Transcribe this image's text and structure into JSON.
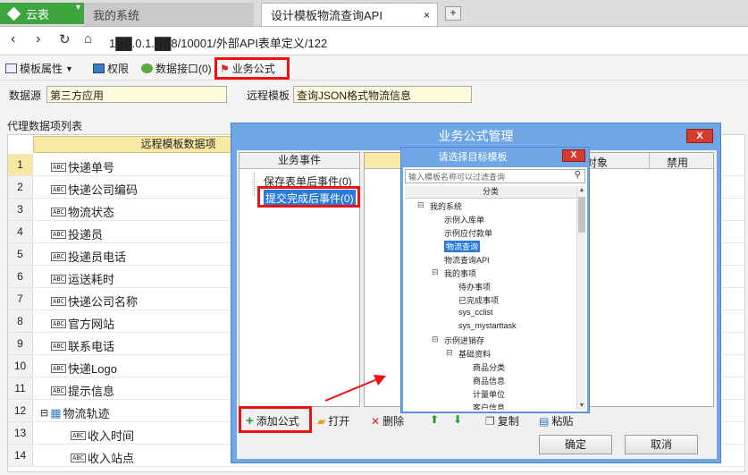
{
  "browser": {
    "brand": "云表",
    "tabs": [
      {
        "label": "我的系统"
      },
      {
        "label": "设计模板物流查询API"
      }
    ],
    "tab_close": "×",
    "new_tab": "+",
    "url": "1██.0.1.██8/10001/外部API表单定义/122"
  },
  "toolbar": {
    "template_props": "模板属性",
    "permissions": "权限",
    "data_interface": "数据接口(0)",
    "business_formula": "业务公式"
  },
  "form": {
    "datasource_label": "数据源",
    "datasource_value": "第三方应用",
    "remote_template_label": "远程模板",
    "remote_template_value": "查询JSON格式物流信息"
  },
  "grid": {
    "title": "代理数据项列表",
    "header": "远程模板数据项",
    "rows": [
      {
        "num": "1",
        "label": "快递单号"
      },
      {
        "num": "2",
        "label": "快递公司编码"
      },
      {
        "num": "3",
        "label": "物流状态"
      },
      {
        "num": "4",
        "label": "投递员"
      },
      {
        "num": "5",
        "label": "投递员电话"
      },
      {
        "num": "6",
        "label": "运送耗时"
      },
      {
        "num": "7",
        "label": "快递公司名称"
      },
      {
        "num": "8",
        "label": "官方网站"
      },
      {
        "num": "9",
        "label": "联系电话"
      },
      {
        "num": "10",
        "label": "快递Logo"
      },
      {
        "num": "11",
        "label": "提示信息"
      },
      {
        "num": "12",
        "label": "物流轨迹"
      },
      {
        "num": "13",
        "label": "收入时间"
      },
      {
        "num": "14",
        "label": "收入站点"
      }
    ]
  },
  "dialog": {
    "title": "业务公式管理",
    "close": "X",
    "events_header": "业务事件",
    "events": [
      "保存表单后事件(0)",
      "提交完成后事件(0)"
    ],
    "right_cols": [
      "对象",
      "禁用"
    ],
    "actions": {
      "add": "添加公式",
      "open": "打开",
      "delete": "删除",
      "copy": "复制",
      "paste": "粘贴"
    },
    "ok": "确定",
    "cancel": "取消"
  },
  "picker": {
    "title": "请选择目标模板",
    "close": "X",
    "filter_placeholder": "输入模板名称可以过滤查询",
    "category_header": "分类",
    "tree": [
      {
        "label": "我的系统",
        "level": 0,
        "toggle": "⊟"
      },
      {
        "label": "示例入库单",
        "level": 1
      },
      {
        "label": "示例应付款单",
        "level": 1
      },
      {
        "label": "物流查询",
        "level": 1,
        "selected": true
      },
      {
        "label": "物流查询API",
        "level": 1
      },
      {
        "label": "我的事项",
        "level": 1,
        "toggle": "⊟"
      },
      {
        "label": "待办事项",
        "level": 2
      },
      {
        "label": "已完成事项",
        "level": 2
      },
      {
        "label": "sys_cclist",
        "level": 2
      },
      {
        "label": "sys_mystarttask",
        "level": 2
      },
      {
        "label": "示例进销存",
        "level": 1,
        "toggle": "⊟"
      },
      {
        "label": "基础资料",
        "level": 2,
        "toggle": "⊟"
      },
      {
        "label": "商品分类",
        "level": 3
      },
      {
        "label": "商品信息",
        "level": 3
      },
      {
        "label": "计量单位",
        "level": 3
      },
      {
        "label": "客户信息",
        "level": 3
      }
    ]
  },
  "colors": {
    "brand_green": "#3ea53e",
    "dialog_blue": "#6fa6e6",
    "highlight_red": "#e11111",
    "selection_blue": "#2a7ad8",
    "header_yellow": "#f7e9a3"
  }
}
